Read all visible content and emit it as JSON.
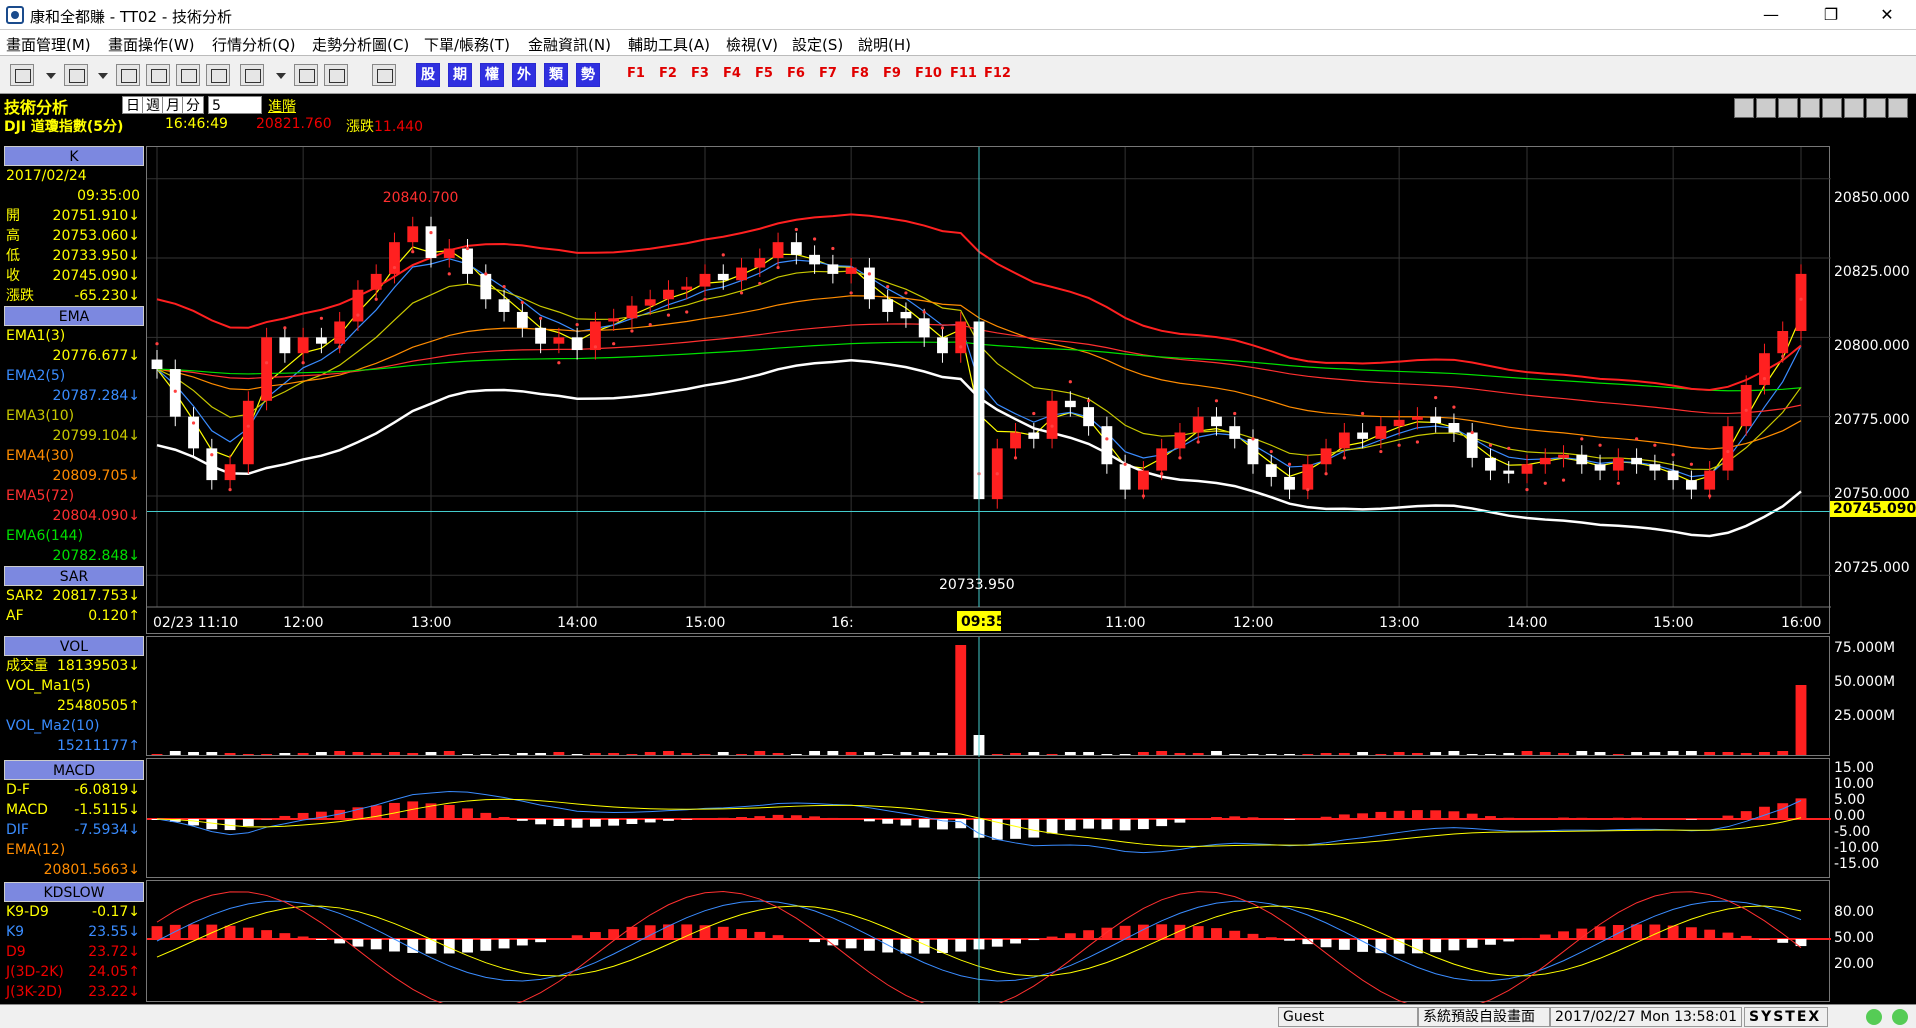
{
  "window": {
    "title": "康和全都賺 - TT02 - 技術分析",
    "min": "—",
    "max": "❐",
    "close": "✕"
  },
  "menu": [
    "畫面管理(M)",
    "畫面操作(W)",
    "行情分析(Q)",
    "走勢分析圖(C)",
    "下單/帳務(T)",
    "金融資訊(N)",
    "輔助工具(A)",
    "檢視(V)",
    "設定(S)",
    "說明(H)"
  ],
  "toolbar": {
    "blue": [
      "股",
      "期",
      "權",
      "外",
      "類",
      "勢"
    ],
    "fkeys": [
      "F1",
      "F2",
      "F3",
      "F4",
      "F5",
      "F6",
      "F7",
      "F8",
      "F9",
      "F10",
      "F11",
      "F12"
    ]
  },
  "header": {
    "title": "技術分析",
    "periods": [
      "日",
      "週",
      "月",
      "分"
    ],
    "interval": "5",
    "advanced": "進階",
    "symbol": "DJI 道瓊指數(5分)",
    "time": "16:46:49",
    "price": "20821.760",
    "change_label": "漲跌",
    "change_value": "11.440"
  },
  "k": {
    "section": "K",
    "date": "2017/02/24",
    "time": "09:35:00",
    "rows": [
      {
        "label": "開",
        "value": "20751.910↓"
      },
      {
        "label": "高",
        "value": "20753.060↓"
      },
      {
        "label": "低",
        "value": "20733.950↓"
      },
      {
        "label": "收",
        "value": "20745.090↓"
      },
      {
        "label": "漲跌",
        "value": "-65.230↓"
      }
    ]
  },
  "ema": {
    "section": "EMA",
    "items": [
      {
        "label": "EMA1(3)",
        "value": "20776.677↓",
        "color": "#ffff00"
      },
      {
        "label": "EMA2(5)",
        "value": "20787.284↓",
        "color": "#3a8cff"
      },
      {
        "label": "EMA3(10)",
        "value": "20799.104↓",
        "color": "#c8c800"
      },
      {
        "label": "EMA4(30)",
        "value": "20809.705↓",
        "color": "#ff8c00"
      },
      {
        "label": "EMA5(72)",
        "value": "20804.090↓",
        "color": "#ff3030"
      },
      {
        "label": "EMA6(144)",
        "value": "20782.848↓",
        "color": "#00e000"
      }
    ]
  },
  "sar": {
    "section": "SAR",
    "rows": [
      {
        "label": "SAR2",
        "value": "20817.753↓"
      },
      {
        "label": "AF",
        "value": "0.120↑"
      }
    ]
  },
  "vol": {
    "section": "VOL",
    "rows": [
      {
        "label": "成交量",
        "value": "18139503↓"
      },
      {
        "label": "VOL_Ma1(5)",
        "value": ""
      },
      {
        "label": "",
        "value": "25480505↑"
      },
      {
        "label": "VOL_Ma2(10)",
        "value": ""
      },
      {
        "label": "",
        "value": "15211177↑"
      }
    ]
  },
  "macd": {
    "section": "MACD",
    "rows": [
      {
        "label": "D-F",
        "value": "-6.0819↓"
      },
      {
        "label": "MACD",
        "value": "-1.5115↓"
      },
      {
        "label": "DIF",
        "value": "-7.5934↓"
      },
      {
        "label": "EMA(12)",
        "value": ""
      },
      {
        "label": "",
        "value": "20801.5663↓"
      }
    ]
  },
  "kd": {
    "section": "KDSLOW",
    "rows": [
      {
        "label": "K9-D9",
        "value": "-0.17↓"
      },
      {
        "label": "K9",
        "value": "23.55↓"
      },
      {
        "label": "D9",
        "value": "23.72↓"
      },
      {
        "label": "J(3D-2K)",
        "value": "24.05↑"
      },
      {
        "label": "J(3K-2D)",
        "value": "23.22↓"
      }
    ]
  },
  "axes": {
    "price": [
      "20850.000",
      "20825.000",
      "20800.000",
      "20775.000",
      "20750.000",
      "20725.000"
    ],
    "current_price": "20745.090",
    "vol": [
      "75.000M",
      "50.000M",
      "25.000M"
    ],
    "macd": [
      "15.00",
      "10.00",
      "5.00",
      "0.00",
      "-5.00",
      "-10.00",
      "-15.00"
    ],
    "kd": [
      "80.00",
      "50.00",
      "20.00"
    ],
    "time": [
      "02/23 11:10",
      "12:00",
      "13:00",
      "14:00",
      "15:00",
      "16:",
      "10:00",
      "11:00",
      "12:00",
      "13:00",
      "14:00",
      "15:00",
      "16:00"
    ],
    "cursor_time": "09:35",
    "high_label": "20840.700",
    "low_label": "20733.950"
  },
  "status": {
    "user": "Guest",
    "layout": "系統預設自設畫面",
    "datetime": "2017/02/27 Mon 13:58:01",
    "brand": "SYSTEX"
  },
  "chart_data": {
    "type": "candlestick",
    "close": [
      20790,
      20775,
      20765,
      20755,
      20760,
      20780,
      20800,
      20795,
      20800,
      20798,
      20805,
      20815,
      20820,
      20830,
      20835,
      20825,
      20828,
      20820,
      20812,
      20808,
      20803,
      20798,
      20800,
      20796,
      20805,
      20806,
      20810,
      20812,
      20815,
      20816,
      20820,
      20818,
      20822,
      20825,
      20830,
      20826,
      20823,
      20820,
      20822,
      20812,
      20808,
      20806,
      20800,
      20795,
      20805,
      20749,
      20765,
      20770,
      20768,
      20780,
      20778,
      20772,
      20760,
      20752,
      20758,
      20765,
      20770,
      20775,
      20772,
      20768,
      20760,
      20756,
      20752,
      20760,
      20765,
      20770,
      20768,
      20772,
      20774,
      20775,
      20773,
      20770,
      20762,
      20758,
      20757,
      20760,
      20762,
      20763,
      20760,
      20758,
      20762,
      20760,
      20758,
      20755,
      20752,
      20758,
      20772,
      20785,
      20795,
      20802,
      20820
    ],
    "high_value": 20840.7,
    "low_value": 20733.95,
    "ylim": [
      20715,
      20860
    ]
  }
}
